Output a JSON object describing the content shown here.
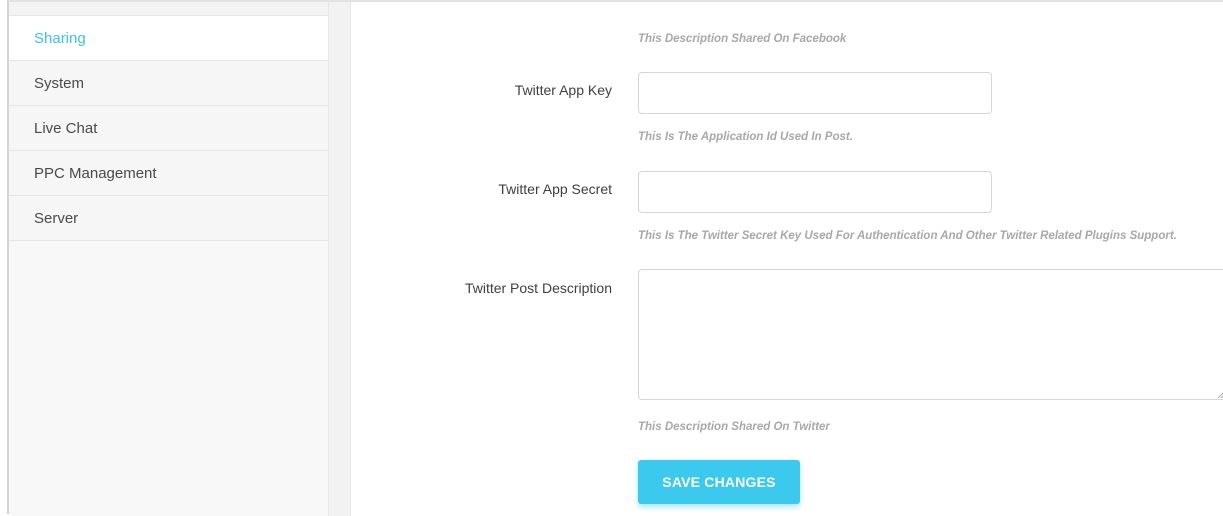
{
  "sidebar": {
    "items": [
      {
        "label": "Sharing",
        "active": true
      },
      {
        "label": "System",
        "active": false
      },
      {
        "label": "Live Chat",
        "active": false
      },
      {
        "label": "PPC Management",
        "active": false
      },
      {
        "label": "Server",
        "active": false
      }
    ]
  },
  "form": {
    "facebook_description_help": "This Description Shared On Facebook",
    "twitter_app_key": {
      "label": "Twitter App Key",
      "value": "",
      "help": "This Is The Application Id Used In Post."
    },
    "twitter_app_secret": {
      "label": "Twitter App Secret",
      "value": "",
      "help": "This Is The Twitter Secret Key Used For Authentication And Other Twitter Related Plugins Support."
    },
    "twitter_post_description": {
      "label": "Twitter Post Description",
      "value": "",
      "help": "This Description Shared On Twitter"
    },
    "save_label": "SAVE CHANGES"
  },
  "colors": {
    "accent": "#3cc9ee",
    "active_nav_text": "#3cc3e6",
    "help_text": "#a8a8a8"
  }
}
